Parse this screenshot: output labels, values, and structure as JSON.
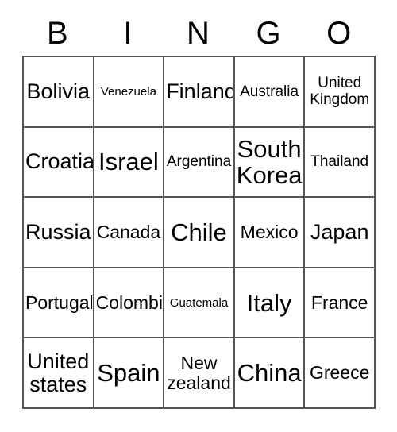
{
  "card": {
    "header_letters": [
      "B",
      "I",
      "N",
      "G",
      "O"
    ],
    "columns": 5,
    "rows": 5,
    "border_color": "#555555",
    "text_color": "#000000",
    "background_color": "#ffffff",
    "cells": [
      {
        "text": "Bolivia",
        "size": "lg",
        "lines": 1
      },
      {
        "text": "Venezuela",
        "size": "xs",
        "lines": 1
      },
      {
        "text": "Finland",
        "size": "lg",
        "lines": 1
      },
      {
        "text": "Australia",
        "size": "sm",
        "lines": 1
      },
      {
        "text": "United\nKingdom",
        "size": "sm",
        "lines": 2
      },
      {
        "text": "Croatia",
        "size": "lg",
        "lines": 1
      },
      {
        "text": "Israel",
        "size": "xl",
        "lines": 1
      },
      {
        "text": "Argentina",
        "size": "sm",
        "lines": 1
      },
      {
        "text": "South\nKorea",
        "size": "xl",
        "lines": 2
      },
      {
        "text": "Thailand",
        "size": "sm",
        "lines": 1
      },
      {
        "text": "Russia",
        "size": "lg",
        "lines": 1
      },
      {
        "text": "Canada",
        "size": "md",
        "lines": 1
      },
      {
        "text": "Chile",
        "size": "xl",
        "lines": 1
      },
      {
        "text": "Mexico",
        "size": "md",
        "lines": 1
      },
      {
        "text": "Japan",
        "size": "lg",
        "lines": 1
      },
      {
        "text": "Portugal",
        "size": "md",
        "lines": 1
      },
      {
        "text": "Colombia",
        "size": "md",
        "lines": 1
      },
      {
        "text": "Guatemala",
        "size": "xs",
        "lines": 1
      },
      {
        "text": "Italy",
        "size": "xl",
        "lines": 1
      },
      {
        "text": "France",
        "size": "md",
        "lines": 1
      },
      {
        "text": "United\nstates",
        "size": "lg",
        "lines": 2
      },
      {
        "text": "Spain",
        "size": "xl",
        "lines": 1
      },
      {
        "text": "New\nzealand",
        "size": "md",
        "lines": 2
      },
      {
        "text": "China",
        "size": "xl",
        "lines": 1
      },
      {
        "text": "Greece",
        "size": "md",
        "lines": 1
      }
    ]
  }
}
